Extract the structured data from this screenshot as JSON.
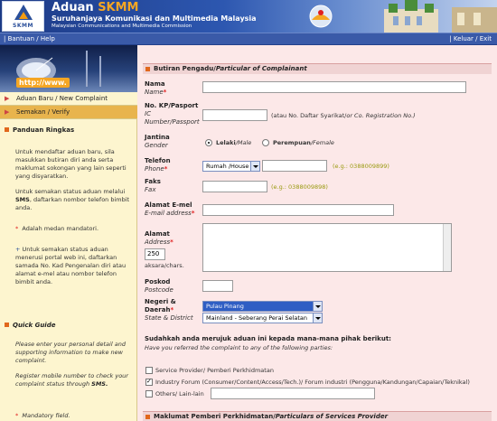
{
  "header": {
    "logo_text": "SKMM",
    "title_prefix": "Aduan",
    "title_brand": "SKMM",
    "subtitle": "Suruhanjaya Komunikasi dan Multimedia Malaysia",
    "subtitle_en": "Malaysian Communications and Multimedia Commission"
  },
  "topnav": {
    "help": "| Bantuan / Help",
    "exit": "| Keluar / Exit"
  },
  "sidebar": {
    "url_banner": "http://www.",
    "nav_new": "Aduan Baru / New Complaint",
    "nav_verify": "Semakan / Verify",
    "guide_title": "Panduan Ringkas",
    "guide_p1": "Untuk mendaftar aduan baru, sila masukkan butiran diri anda serta maklumat sokongan yang lain seperti yang disyaratkan.",
    "guide_p2a": "Untuk semakan status aduan melalui",
    "guide_p2b": "SMS",
    "guide_p2c": ", daftarkan nombor telefon bimbit anda.",
    "guide_star": "*",
    "guide_p3": "Adalah medan mandatori.",
    "guide_plus": "+",
    "guide_p4": "Untuk semakan status aduan menerusi portal web ini, daftarkan samada No. Kad Pengenalan diri atau alamat e-mel atau nombor telefon bimbit anda.",
    "quick_title": "Quick Guide",
    "quick_p1": "Please enter your personal detail and supporting information to make new complaint.",
    "quick_p2a": "Register mobile number to check your complaint status through",
    "quick_p2b": "SMS.",
    "quick_star": "*",
    "quick_p3": "Mandatory field."
  },
  "form": {
    "section1": "Butiran Pengadu/",
    "section1_en": "Particular of Complainant",
    "name_label": "Nama",
    "name_en": "Name",
    "ic_label": "No. KP/Pasport",
    "ic_en1": "IC",
    "ic_en2": "Number/Passport",
    "ic_hint_a": "(atau No. Daftar Syarikat/",
    "ic_hint_b": "or Co. Registration No.)",
    "gender_label": "Jantina",
    "gender_en": "Gender",
    "male": "Lelaki",
    "male_en": "/Male",
    "female": "Perempuan",
    "female_en": "/Female",
    "phone_label": "Telefon",
    "phone_en": "Phone",
    "phone_type": "Rumah /House",
    "phone_hint": "(e.g.: 0388009899)",
    "fax_label": "Faks",
    "fax_en": "Fax",
    "fax_hint": "(e.g.: 0388009898)",
    "email_label": "Alamat E-mel",
    "email_en": "E-mail address",
    "address_label": "Alamat",
    "address_en": "Address",
    "address_counter": "250",
    "address_counter_label": "aksara/chars.",
    "postcode_label": "Poskod",
    "postcode_en": "Postcode",
    "state_label": "Negeri &",
    "state_label2": "Daerah",
    "state_en": "State & District",
    "state_value": "Pulau Pinang",
    "district_value": "Mainland - Seberang Perai Selatan",
    "referred_q": "Sudahkah anda merujuk aduan ini kepada mana-mana pihak berikut:",
    "referred_q_en": "Have you referred the complaint to any of the following parties:",
    "opt_provider": "Service Provider/ Pemberi Perkhidmatan",
    "opt_forum": "Industry Forum (Consumer/Content/Access/Tech.)/ Forum industri (Pengguna/Kandungan/Capaian/Teknikal)",
    "opt_other": "Others/ Lain-lain",
    "section2": "Maklumat Pemberi Perkhidmatan/",
    "section2_en": "Particulars of Services Provider",
    "star": "*"
  },
  "colors": {
    "header_blue": "#2d57b0",
    "sidebar_bg": "#fdf5cf",
    "form_bg": "#fce8e8",
    "accent_orange": "#e1671c",
    "mandatory_red": "#e02020"
  }
}
